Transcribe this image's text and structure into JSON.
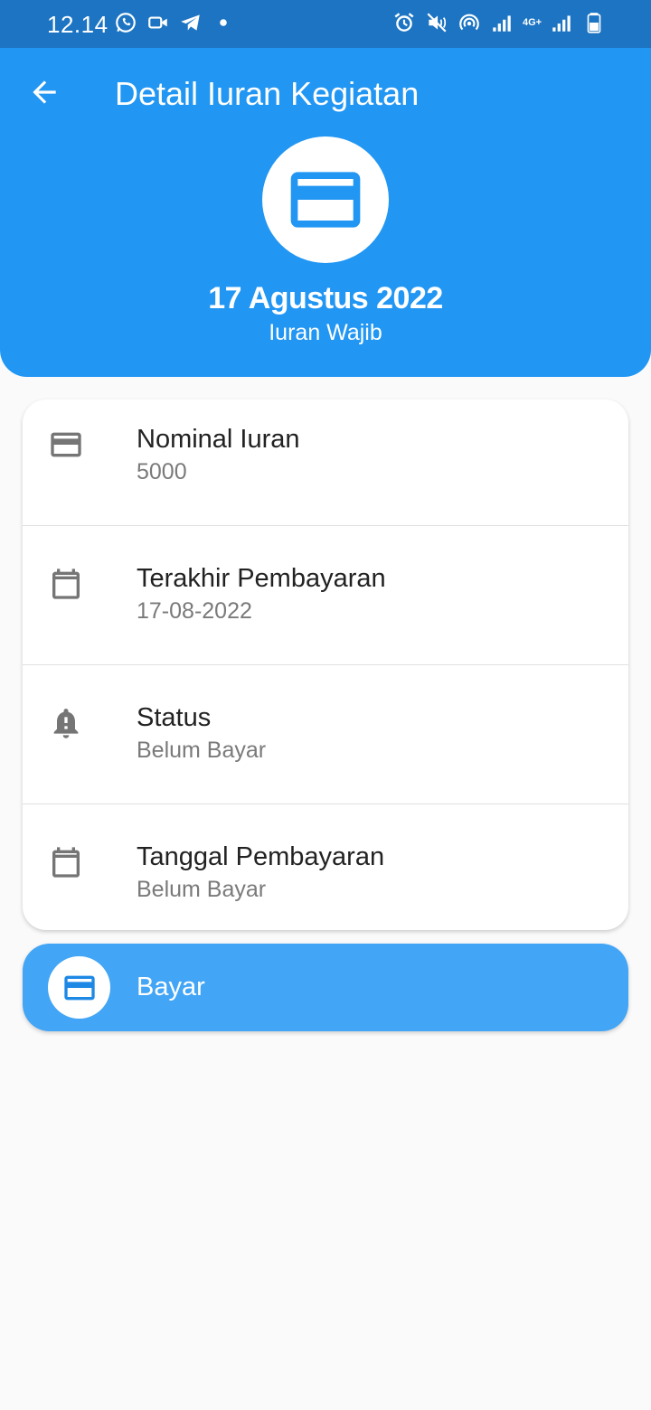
{
  "status_bar": {
    "time": "12.14",
    "network_label": "4G+",
    "left_icons": [
      "whatsapp-icon",
      "video-call-icon",
      "telegram-icon",
      "dot-icon"
    ],
    "right_icons": [
      "alarm-icon",
      "mute-icon",
      "hotspot-icon",
      "signal-icon",
      "4g-icon",
      "signal-icon",
      "battery-icon"
    ]
  },
  "header": {
    "title": "Detail Iuran Kegiatan",
    "date": "17 Agustus 2022",
    "subtitle": "Iuran Wajib",
    "icon": "credit-card-icon"
  },
  "details": [
    {
      "icon": "credit-card-icon",
      "label": "Nominal Iuran",
      "value": "5000"
    },
    {
      "icon": "calendar-icon",
      "label": "Terakhir Pembayaran",
      "value": "17-08-2022"
    },
    {
      "icon": "bell-alert-icon",
      "label": "Status",
      "value": "Belum Bayar"
    },
    {
      "icon": "calendar-icon",
      "label": "Tanggal Pembayaran",
      "value": "Belum Bayar"
    }
  ],
  "pay_button": {
    "label": "Bayar",
    "icon": "credit-card-icon"
  },
  "colors": {
    "status_bar": "#1c74c2",
    "header": "#2196f3",
    "pay_button": "#42a5f5",
    "icon_gray": "#757575"
  }
}
